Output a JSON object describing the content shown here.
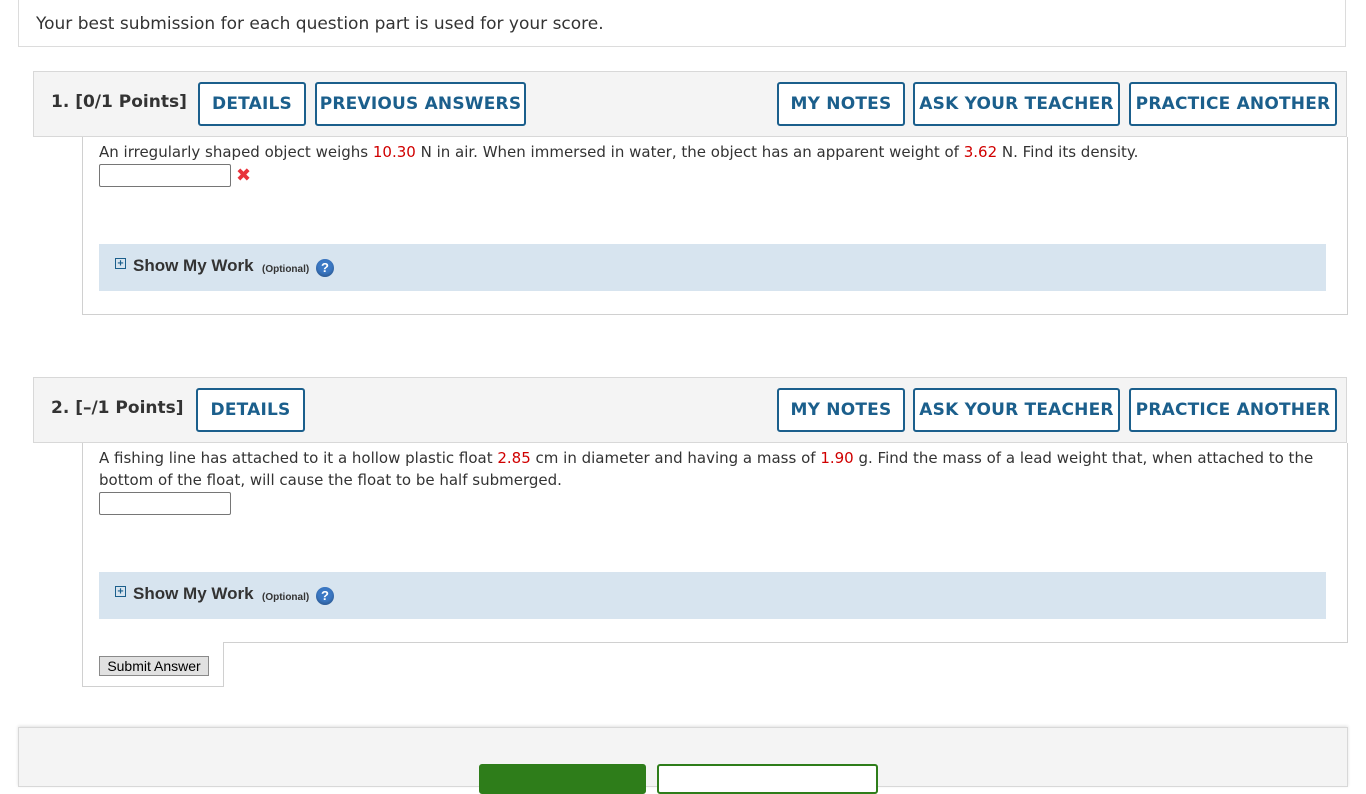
{
  "info": {
    "text": "Your best submission for each question part is used for your score."
  },
  "questions": [
    {
      "title": "1.  [0/1 Points]",
      "buttons": {
        "details": "DETAILS",
        "previous_answers": "PREVIOUS ANSWERS",
        "my_notes": "MY NOTES",
        "ask_teacher": "ASK YOUR TEACHER",
        "practice_another": "PRACTICE ANOTHER"
      },
      "text": {
        "p1": "An irregularly shaped object weighs ",
        "v1": "10.30",
        "p2": " N in air. When immersed in water, the object has an apparent weight of ",
        "v2": "3.62",
        "p3": " N. Find its density."
      },
      "answer_value": "",
      "status": "incorrect",
      "show_my_work": {
        "label": "Show My Work",
        "optional": "(Optional)",
        "help": "?"
      }
    },
    {
      "title": "2.  [–/1 Points]",
      "buttons": {
        "details": "DETAILS",
        "my_notes": "MY NOTES",
        "ask_teacher": "ASK YOUR TEACHER",
        "practice_another": "PRACTICE ANOTHER"
      },
      "text": {
        "p1": "A fishing line has attached to it a hollow plastic float ",
        "v1": "2.85",
        "p2": " cm in diameter and having a mass of ",
        "v2": "1.90",
        "p3": " g. Find the mass of a lead weight that, when attached to the bottom of the float, will cause the float to be half submerged."
      },
      "answer_value": "",
      "show_my_work": {
        "label": "Show My Work",
        "optional": "(Optional)",
        "help": "?"
      }
    }
  ],
  "submit": {
    "label": "Submit Answer"
  },
  "colors": {
    "accent": "#1b5f8c",
    "given_value": "#d00000",
    "show_my_work_bg": "#d7e4ef",
    "footer_button": "#2e7d1a"
  }
}
